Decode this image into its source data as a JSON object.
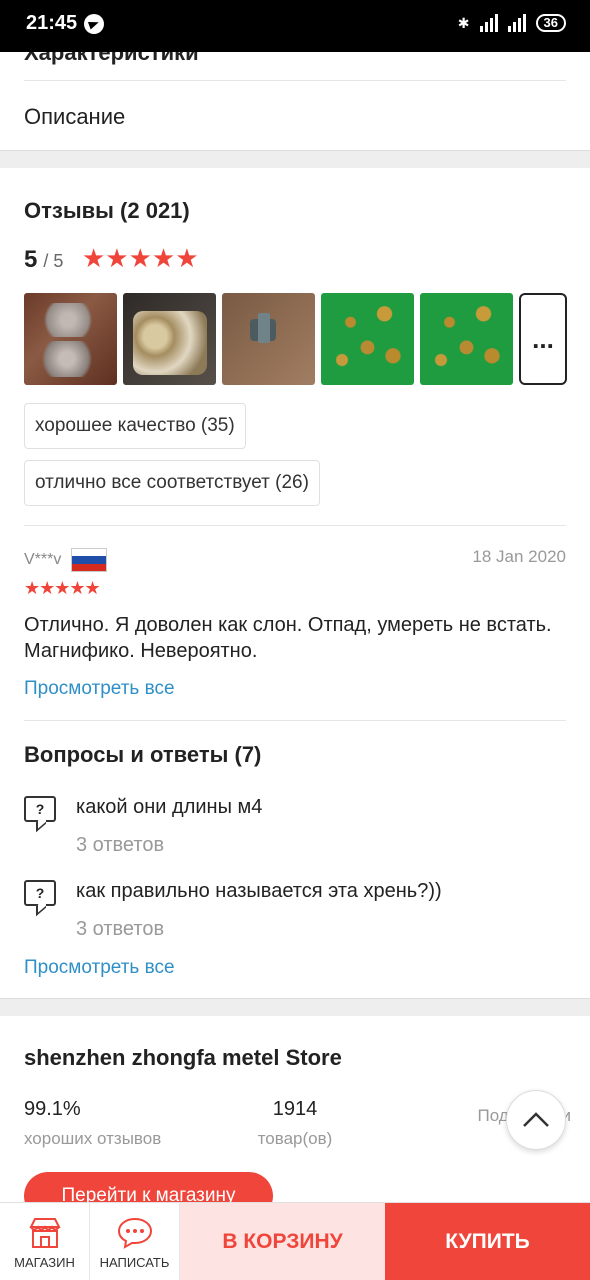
{
  "status": {
    "time": "21:45",
    "battery": "36"
  },
  "sections": {
    "characteristics": "Характеристики",
    "description": "Описание"
  },
  "reviews": {
    "title": "Отзывы (2 021)",
    "score": "5",
    "score_of": "/ 5",
    "stars": "★★★★★",
    "more_label": "...",
    "tags": [
      "хорошее качество (35)",
      "отлично все соответствует (26)"
    ],
    "item": {
      "user": "V***v",
      "date": "18 Jan 2020",
      "stars": "★★★★★",
      "text": "Отлично. Я доволен как слон. Отпад, умереть не встать. Магнифико. Невероятно."
    },
    "view_all": "Просмотреть все"
  },
  "qa": {
    "title": "Вопросы и ответы (7)",
    "items": [
      {
        "question": "какой они длины м4",
        "answers": "3 ответов"
      },
      {
        "question": "как правильно называется эта хрень?))",
        "answers": "3 ответов"
      }
    ],
    "view_all": "Просмотреть все"
  },
  "store": {
    "name": "shenzhen zhongfa metel Store",
    "stats": [
      {
        "value": "99.1%",
        "label": "хороших отзывов"
      },
      {
        "value": "1914",
        "label": "товар(ов)"
      },
      {
        "value": "",
        "label": "Подписчики"
      }
    ],
    "goto": "Перейти к магазину"
  },
  "bottom": {
    "shop": "МАГАЗИН",
    "write": "НАПИСАТЬ",
    "cart": "В КОРЗИНУ",
    "buy": "КУПИТЬ"
  },
  "colors": {
    "accent": "#f0453a",
    "link": "#2f8fc7"
  }
}
